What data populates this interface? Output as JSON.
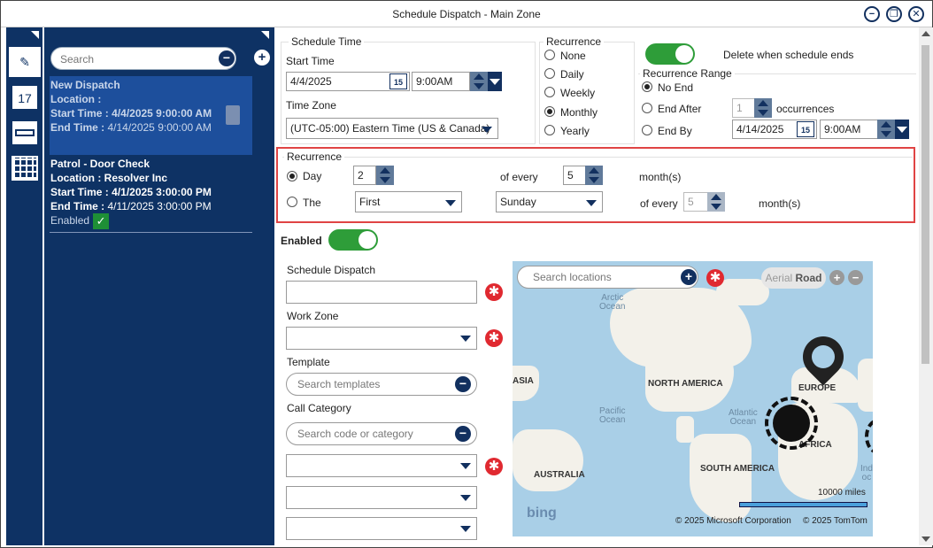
{
  "window": {
    "title": "Schedule Dispatch - Main Zone"
  },
  "list": {
    "search_placeholder": "Search",
    "items": [
      {
        "title": "New Dispatch",
        "location_label": "Location :",
        "location": "",
        "start_label": "Start Time :",
        "start": "4/4/2025 9:00:00 AM",
        "end_label": "End Time :",
        "end": "4/14/2025 9:00:00 AM"
      },
      {
        "title": "Patrol - Door Check",
        "location_label": "Location :",
        "location": "Resolver Inc",
        "start_label": "Start Time :",
        "start": "4/1/2025 3:00:00 PM",
        "end_label": "End Time :",
        "end": "4/11/2025 3:00:00 PM",
        "status": "Enabled"
      }
    ]
  },
  "iconbar": {
    "calendar_day": "17"
  },
  "schedule_time": {
    "legend": "Schedule Time",
    "start_time_label": "Start Time",
    "start_date": "4/4/2025",
    "start_time": "9:00AM",
    "time_zone_label": "Time Zone",
    "time_zone": "(UTC-05:00) Eastern Time (US & Canada)",
    "calendar_icon_day": "15"
  },
  "recurrence_type": {
    "legend": "Recurrence",
    "options": [
      "None",
      "Daily",
      "Weekly",
      "Monthly",
      "Yearly"
    ],
    "selected": "Monthly"
  },
  "delete_when_ends": {
    "label": "Delete when schedule ends",
    "on": true
  },
  "range": {
    "legend": "Recurrence Range",
    "no_end": "No End",
    "end_after": "End After",
    "occurrences_value": "1",
    "occurrences_label": "occurrences",
    "end_by": "End By",
    "end_date": "4/14/2025",
    "end_time": "9:00AM",
    "selected": "No End"
  },
  "monthly": {
    "legend": "Recurrence",
    "day_label": "Day",
    "day_value": "2",
    "of_every": "of every",
    "every_value": "5",
    "months": "month(s)",
    "the_label": "The",
    "ordinal": "First",
    "weekday": "Sunday",
    "of_every2": "of every",
    "every_value2": "5",
    "months2": "month(s)",
    "selected": "Day"
  },
  "enabled": {
    "label": "Enabled",
    "on": true
  },
  "form": {
    "schedule_dispatch_label": "Schedule Dispatch",
    "work_zone_label": "Work Zone",
    "template_label": "Template",
    "template_placeholder": "Search templates",
    "call_category_label": "Call Category",
    "call_category_placeholder": "Search code or category"
  },
  "map": {
    "search_placeholder": "Search locations",
    "aerial": "Aerial",
    "road": "Road",
    "labels": {
      "north_america": "NORTH AMERICA",
      "south_america": "SOUTH AMERICA",
      "europe": "EUROPE",
      "africa": "AFRICA",
      "australia": "AUSTRALIA",
      "asia": "ASIA"
    },
    "oceans": {
      "arctic": "Arctic\nOcean",
      "pacific": "Pacific\nOcean",
      "atlantic": "Atlantic\nOcean",
      "indian": "Ind\noc"
    },
    "scale": "10000 miles",
    "copyright_ms": "© 2025 Microsoft Corporation",
    "copyright_tt": "© 2025 TomTom",
    "brand": "bing"
  },
  "colors": {
    "accent": "#0e3264",
    "selected": "#1d4f9c",
    "toggle": "#2e9d39",
    "required": "#e02930",
    "highlight": "#e04444"
  }
}
